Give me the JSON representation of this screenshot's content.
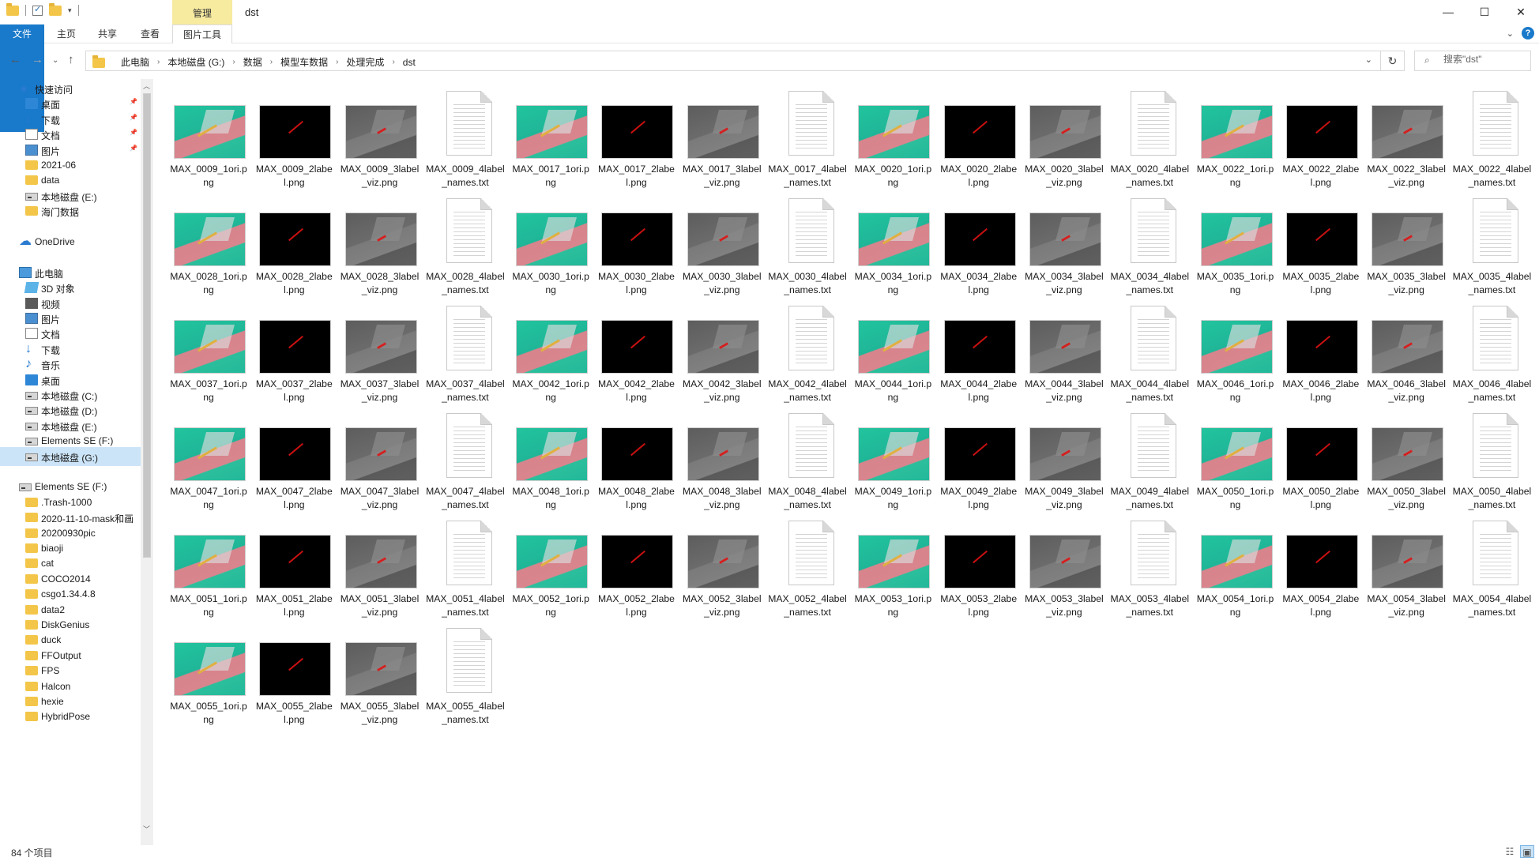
{
  "window": {
    "title": "dst",
    "context_tab": "管理",
    "controls": {
      "minimize": "—",
      "maximize": "☐",
      "close": "✕"
    }
  },
  "ribbon": {
    "file_tab": "文件",
    "tabs": [
      "主页",
      "共享",
      "查看"
    ],
    "picture_tools_tab": "图片工具"
  },
  "address": {
    "crumbs": [
      "此电脑",
      "本地磁盘 (G:)",
      "数据",
      "模型车数据",
      "处理完成",
      "dst"
    ],
    "search_placeholder": "搜索\"dst\""
  },
  "navigation": {
    "items": [
      {
        "label": "快速访问",
        "icon": "star-icon",
        "indent": 0,
        "pinned": false
      },
      {
        "label": "桌面",
        "icon": "desktop-icon",
        "indent": 1,
        "pinned": true
      },
      {
        "label": "下载",
        "icon": "download-icon",
        "indent": 1,
        "pinned": true
      },
      {
        "label": "文档",
        "icon": "document-icon",
        "indent": 1,
        "pinned": true
      },
      {
        "label": "图片",
        "icon": "picture-icon",
        "indent": 1,
        "pinned": true
      },
      {
        "label": "2021-06",
        "icon": "folder-icon",
        "indent": 1,
        "pinned": false
      },
      {
        "label": "data",
        "icon": "folder-icon",
        "indent": 1,
        "pinned": false
      },
      {
        "label": "本地磁盘 (E:)",
        "icon": "drive-icon",
        "indent": 1,
        "pinned": false
      },
      {
        "label": "海门数据",
        "icon": "folder-icon",
        "indent": 1,
        "pinned": false
      },
      {
        "label": "",
        "icon": "",
        "indent": 0,
        "pinned": false
      },
      {
        "label": "OneDrive",
        "icon": "cloud-icon",
        "indent": 0,
        "pinned": false
      },
      {
        "label": "",
        "icon": "",
        "indent": 0,
        "pinned": false
      },
      {
        "label": "此电脑",
        "icon": "pc-icon",
        "indent": 0,
        "pinned": false
      },
      {
        "label": "3D 对象",
        "icon": "3d-objects-icon",
        "indent": 1,
        "pinned": false
      },
      {
        "label": "视频",
        "icon": "video-icon",
        "indent": 1,
        "pinned": false
      },
      {
        "label": "图片",
        "icon": "picture-icon",
        "indent": 1,
        "pinned": false
      },
      {
        "label": "文档",
        "icon": "document-icon",
        "indent": 1,
        "pinned": false
      },
      {
        "label": "下载",
        "icon": "download-icon",
        "indent": 1,
        "pinned": false
      },
      {
        "label": "音乐",
        "icon": "music-icon",
        "indent": 1,
        "pinned": false
      },
      {
        "label": "桌面",
        "icon": "desktop-icon",
        "indent": 1,
        "pinned": false
      },
      {
        "label": "本地磁盘 (C:)",
        "icon": "drive-icon",
        "indent": 1,
        "pinned": false
      },
      {
        "label": "本地磁盘 (D:)",
        "icon": "drive-icon",
        "indent": 1,
        "pinned": false
      },
      {
        "label": "本地磁盘 (E:)",
        "icon": "drive-icon",
        "indent": 1,
        "pinned": false
      },
      {
        "label": "Elements SE (F:)",
        "icon": "drive-icon",
        "indent": 1,
        "pinned": false
      },
      {
        "label": "本地磁盘 (G:)",
        "icon": "drive-icon",
        "indent": 1,
        "pinned": false,
        "selected": true
      },
      {
        "label": "",
        "icon": "",
        "indent": 0,
        "pinned": false
      },
      {
        "label": "Elements SE (F:)",
        "icon": "drive-icon",
        "indent": 0,
        "pinned": false
      },
      {
        "label": ".Trash-1000",
        "icon": "folder-icon",
        "indent": 1,
        "pinned": false
      },
      {
        "label": "2020-11-10-mask和画",
        "icon": "folder-icon",
        "indent": 1,
        "pinned": false
      },
      {
        "label": "20200930pic",
        "icon": "folder-icon",
        "indent": 1,
        "pinned": false
      },
      {
        "label": "biaoji",
        "icon": "folder-icon",
        "indent": 1,
        "pinned": false
      },
      {
        "label": "cat",
        "icon": "folder-icon",
        "indent": 1,
        "pinned": false
      },
      {
        "label": "COCO2014",
        "icon": "folder-icon",
        "indent": 1,
        "pinned": false
      },
      {
        "label": "csgo1.34.4.8",
        "icon": "folder-icon",
        "indent": 1,
        "pinned": false
      },
      {
        "label": "data2",
        "icon": "folder-icon",
        "indent": 1,
        "pinned": false
      },
      {
        "label": "DiskGenius",
        "icon": "folder-icon",
        "indent": 1,
        "pinned": false
      },
      {
        "label": "duck",
        "icon": "folder-icon",
        "indent": 1,
        "pinned": false
      },
      {
        "label": "FFOutput",
        "icon": "folder-icon",
        "indent": 1,
        "pinned": false
      },
      {
        "label": "FPS",
        "icon": "folder-icon",
        "indent": 1,
        "pinned": false
      },
      {
        "label": "Halcon",
        "icon": "folder-icon",
        "indent": 1,
        "pinned": false
      },
      {
        "label": "hexie",
        "icon": "folder-icon",
        "indent": 1,
        "pinned": false
      },
      {
        "label": "HybridPose",
        "icon": "folder-icon",
        "indent": 1,
        "pinned": false
      }
    ]
  },
  "files": {
    "groups": [
      "0009",
      "0017",
      "0020",
      "0022",
      "0028",
      "0030",
      "0034",
      "0035",
      "0037",
      "0042",
      "0044",
      "0046",
      "0047",
      "0048",
      "0049",
      "0050",
      "0051",
      "0052",
      "0053",
      "0054",
      "0055"
    ],
    "prefix": "MAX_",
    "suffixes": [
      "_1ori.png",
      "_2label.png",
      "_3label_viz.png",
      "_4label_names.txt"
    ],
    "kinds": [
      "orig",
      "label",
      "viz",
      "txt"
    ]
  },
  "status": {
    "item_count": "84 个项目"
  }
}
